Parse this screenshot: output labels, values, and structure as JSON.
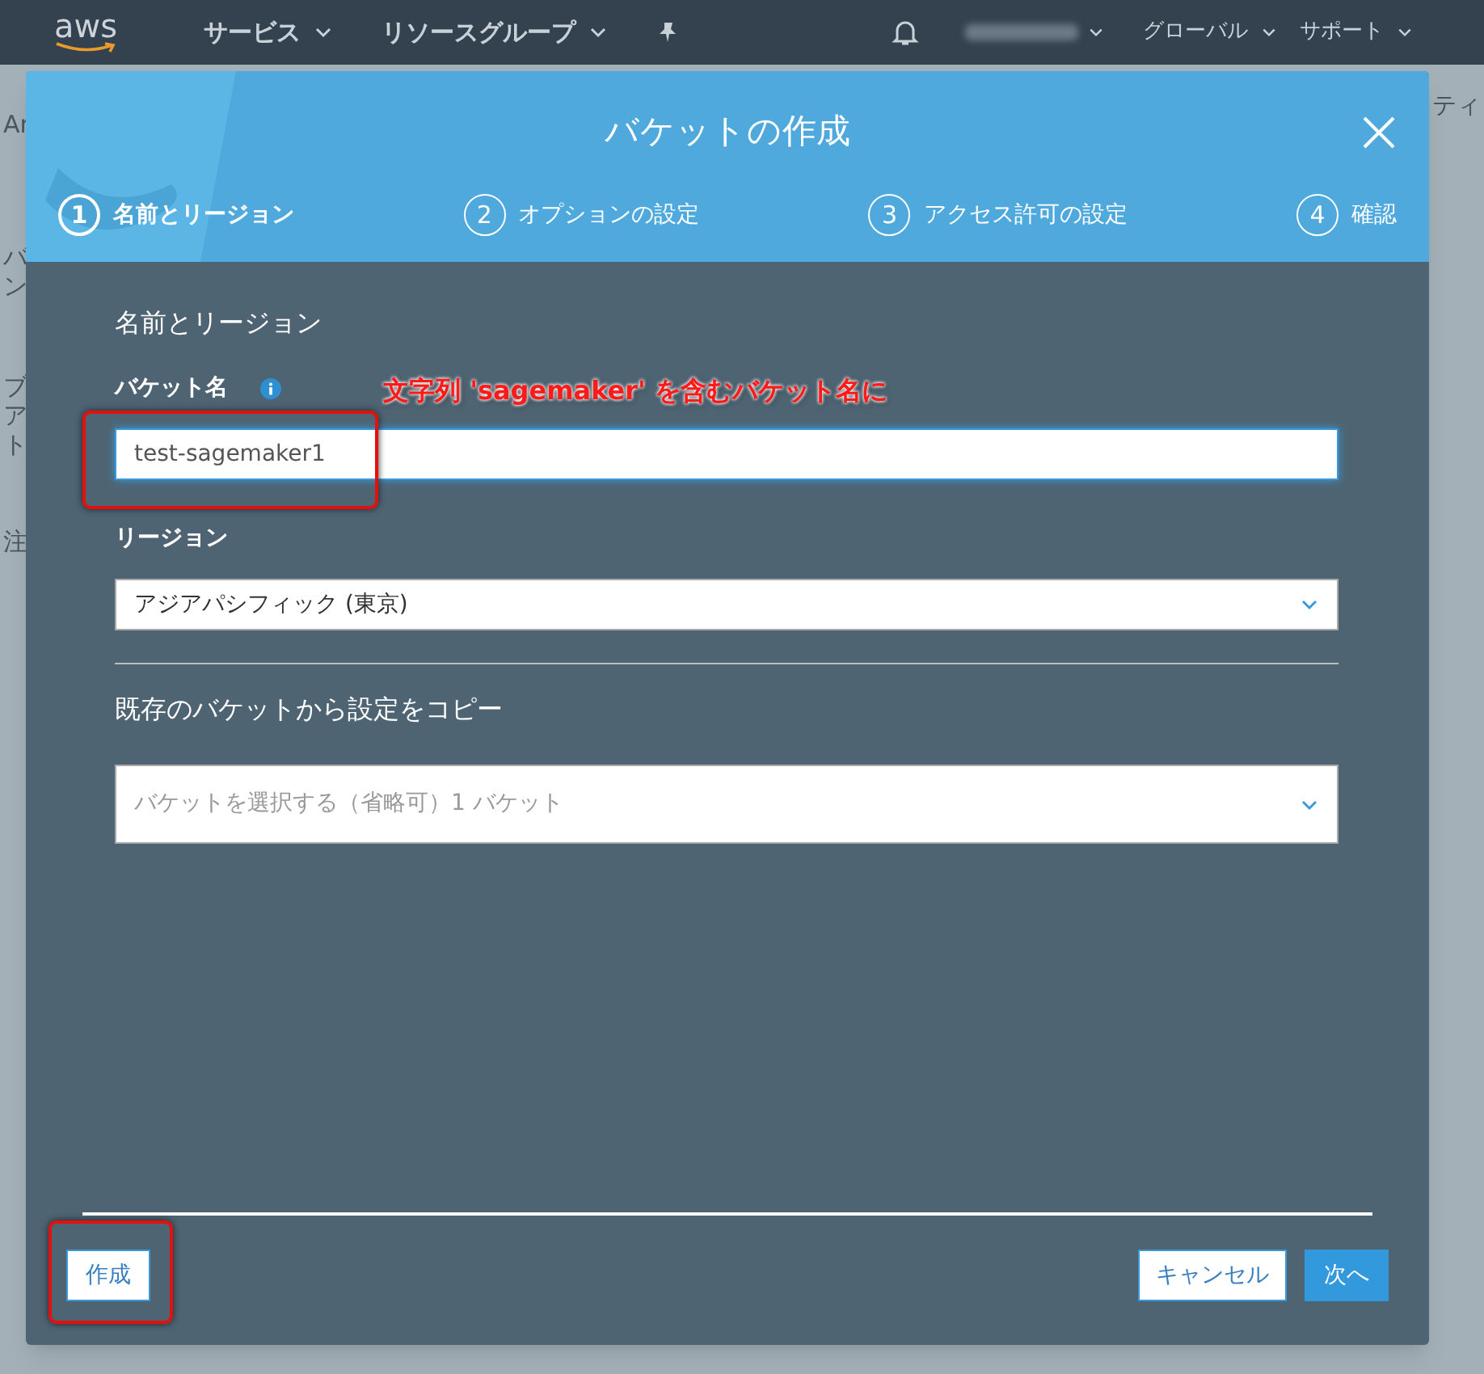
{
  "nav": {
    "logo": "aws",
    "menus": [
      {
        "label": "サービス"
      },
      {
        "label": "リソースグループ"
      }
    ],
    "right_menus": [
      {
        "label": "グローバル"
      },
      {
        "label": "サポート"
      }
    ]
  },
  "background_page": {
    "left_fragments": [
      "Ar",
      "バ",
      "ン",
      "ブ",
      "ア",
      "ト",
      "注"
    ],
    "right_fragment": "ティ"
  },
  "dialog": {
    "title": "バケットの作成",
    "steps": [
      {
        "number": "1",
        "label": "名前とリージョン",
        "selected": true
      },
      {
        "number": "2",
        "label": "オプションの設定",
        "selected": false
      },
      {
        "number": "3",
        "label": "アクセス許可の設定",
        "selected": false
      },
      {
        "number": "4",
        "label": "確認",
        "selected": false
      }
    ],
    "section_title": "名前とリージョン",
    "bucket_name": {
      "label": "バケット名",
      "value": "test-sagemaker1"
    },
    "region": {
      "label": "リージョン",
      "value": "アジアパシフィック (東京)"
    },
    "copy_section_title": "既存のバケットから設定をコピー",
    "copy_select": {
      "placeholder": "バケットを選択する（省略可）1 バケット"
    },
    "create_button": "作成",
    "cancel_button": "キャンセル",
    "next_button": "次へ"
  },
  "annotations": {
    "text": "文字列 'sagemaker' を含むバケット名に"
  }
}
